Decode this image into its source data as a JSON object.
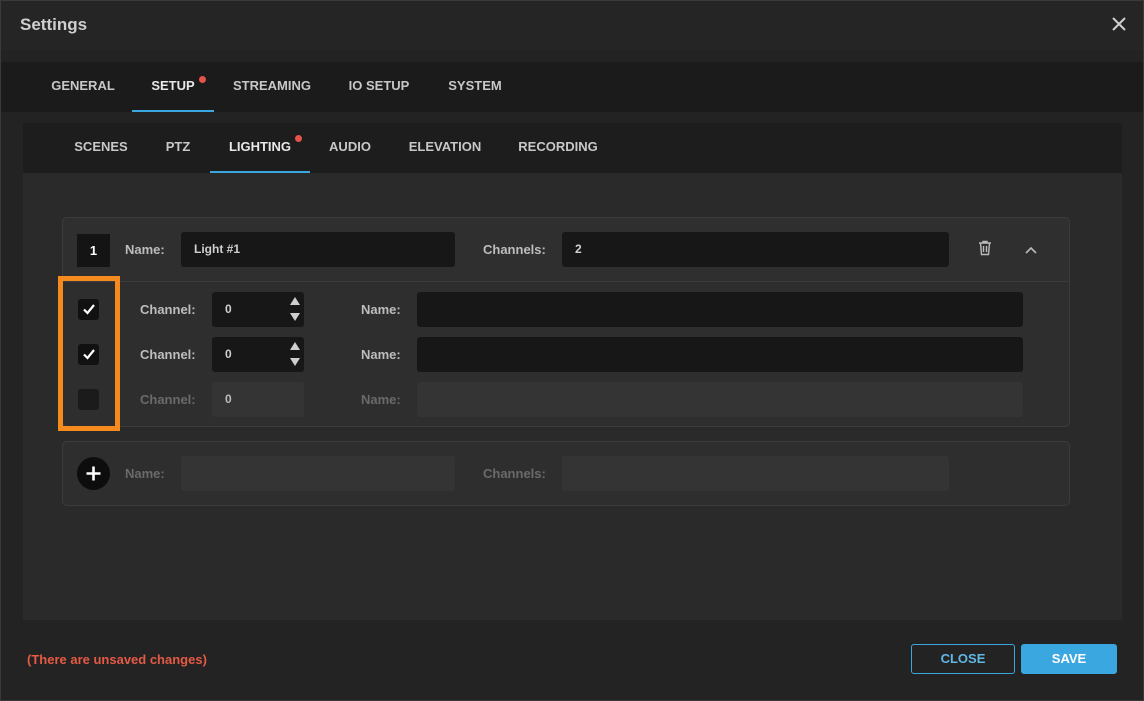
{
  "window": {
    "title": "Settings"
  },
  "main_tabs": [
    {
      "label": "GENERAL",
      "active": false,
      "dot": false
    },
    {
      "label": "SETUP",
      "active": true,
      "dot": true
    },
    {
      "label": "STREAMING",
      "active": false,
      "dot": false
    },
    {
      "label": "IO SETUP",
      "active": false,
      "dot": false
    },
    {
      "label": "SYSTEM",
      "active": false,
      "dot": false
    }
  ],
  "sub_tabs": [
    {
      "label": "SCENES",
      "active": false,
      "dot": false
    },
    {
      "label": "PTZ",
      "active": false,
      "dot": false
    },
    {
      "label": "LIGHTING",
      "active": true,
      "dot": true
    },
    {
      "label": "AUDIO",
      "active": false,
      "dot": false
    },
    {
      "label": "ELEVATION",
      "active": false,
      "dot": false
    },
    {
      "label": "RECORDING",
      "active": false,
      "dot": false
    }
  ],
  "light": {
    "number": "1",
    "name_label": "Name:",
    "name_value": "Light #1",
    "channels_label": "Channels:",
    "channels_value": "2",
    "channels": [
      {
        "checked": true,
        "channel_label": "Channel:",
        "channel_value": "0",
        "name_label": "Name:",
        "name_value": ""
      },
      {
        "checked": true,
        "channel_label": "Channel:",
        "channel_value": "0",
        "name_label": "Name:",
        "name_value": ""
      },
      {
        "checked": false,
        "channel_label": "Channel:",
        "channel_value": "0",
        "name_label": "Name:",
        "name_value": ""
      }
    ]
  },
  "new_light": {
    "name_label": "Name:",
    "name_value": "",
    "channels_label": "Channels:",
    "channels_value": ""
  },
  "footer": {
    "unsaved_message": "(There are unsaved changes)",
    "close_label": "CLOSE",
    "save_label": "SAVE"
  },
  "icons": {
    "close": "close-icon",
    "delete": "trash-icon",
    "collapse": "chevron-up-icon",
    "check": "checkmark-icon",
    "stepper": "stepper-arrows-icon",
    "add": "plus-icon"
  },
  "colors": {
    "accent": "#3aa7e0",
    "warning": "#e55a45",
    "highlight": "#f58a1f",
    "notification_dot": "#e5534b"
  }
}
